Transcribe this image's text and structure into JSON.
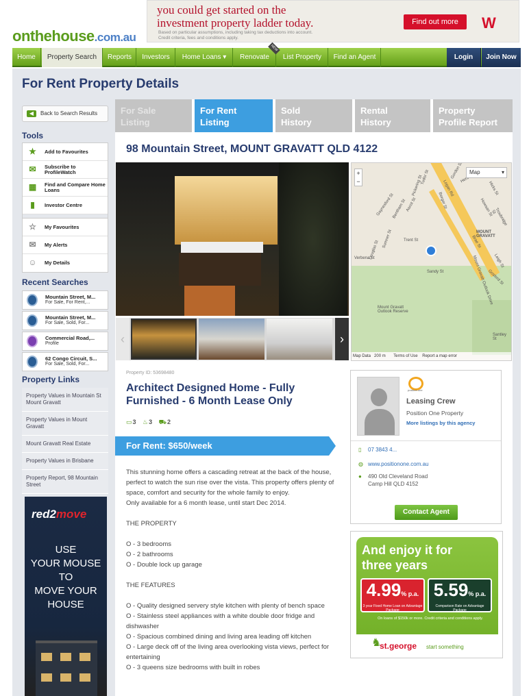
{
  "logo": {
    "part1": "onthehouse",
    "part2": ".com.au"
  },
  "banner": {
    "title_line1": "you could get started on the",
    "title_line2": "investment property ladder today.",
    "small1": "Based on particular assumptions, including taking tax deductions into account.",
    "small2": "Credit criteria, fees and conditions apply.",
    "button": "Find out more",
    "brand_mark": "W"
  },
  "nav": {
    "items": [
      "Home",
      "Property Search",
      "Reports",
      "Investors",
      "Home Loans ▾",
      "Renovate",
      "List Property",
      "Find an Agent"
    ],
    "new_tag": "NEW",
    "login": "Login",
    "join": "Join Now"
  },
  "page": {
    "title": "For Rent Property Details"
  },
  "sidebar": {
    "back": "Back to Search Results",
    "tools_heading": "Tools",
    "tools": [
      {
        "label": "Add to Favourites",
        "icon": "star-icon"
      },
      {
        "label": "Subscribe to ProfileWatch",
        "icon": "mail-icon"
      },
      {
        "label": "Find and Compare Home Loans",
        "icon": "calculator-icon"
      },
      {
        "label": "Investor Centre",
        "icon": "bar-chart-icon"
      }
    ],
    "user_tools": [
      {
        "label": "My Favourites",
        "icon": "star-outline-icon"
      },
      {
        "label": "My Alerts",
        "icon": "envelope-icon"
      },
      {
        "label": "My Details",
        "icon": "user-icon"
      }
    ],
    "recent_heading": "Recent Searches",
    "recent": [
      {
        "title": "Mountain Street, M...",
        "sub": "For Sale, For Rent,..."
      },
      {
        "title": "Mountain Street, M...",
        "sub": "For Sale, Sold, For..."
      },
      {
        "title": "Commercial Road,...",
        "sub": "Profile"
      },
      {
        "title": "62 Congo Circuit, S...",
        "sub": "For Sale, Sold, For..."
      }
    ],
    "links_heading": "Property Links",
    "links": [
      "Property Values in Mountain St Mount Gravatt",
      "Property Values in Mount Gravatt",
      "Mount Gravatt Real Estate",
      "Property Values in Brisbane",
      "Property Report, 98 Mountain Street"
    ],
    "ad": {
      "brand_a": "red2",
      "brand_b": "move",
      "text": [
        "USE",
        "YOUR MOUSE",
        "TO",
        "MOVE YOUR",
        "HOUSE"
      ]
    }
  },
  "tabs": [
    {
      "line1": "For Sale",
      "line2": "Listing"
    },
    {
      "line1": "For Rent",
      "line2": "Listing"
    },
    {
      "line1": "Sold",
      "line2": "History"
    },
    {
      "line1": "Rental",
      "line2": "History"
    },
    {
      "line1": "Property",
      "line2": "Profile Report"
    }
  ],
  "property": {
    "address": "98 Mountain Street, MOUNT GRAVATT QLD 4122",
    "id_label": "Property ID: 53698480",
    "headline": "Architect Designed Home - Fully Furnished - 6 Month Lease Only",
    "bedrooms": "3",
    "bathrooms": "3",
    "cars": "2",
    "price": "For Rent: $650/week",
    "description": [
      "This stunning home offers a cascading retreat at the back of the house, perfect to watch the sun rise over the vista. This property offers plenty of space, comfort and security for the whole family to enjoy.",
      "Only available for a 6 month lease, until start Dec 2014.",
      "",
      "THE PROPERTY",
      "",
      "O - 3 bedrooms",
      "O - 2 bathrooms",
      "O - Double lock up garage",
      "",
      "THE FEATURES",
      "",
      "O - Quality designed servery style kitchen with plenty of bench space",
      "O - Stainless steel appliances with a white double door fridge and dishwasher",
      "O - Spacious combined dining and living area leading off kitchen",
      "O - Large deck off of the living area overlooking vista views, perfect for entertaining",
      "O - 3 queens size bedrooms with built in robes"
    ]
  },
  "map": {
    "type_select": "Map",
    "zoom_in": "+",
    "zoom_out": "−",
    "labels": [
      "Logan Rd",
      "Mount Gravatt Outlook Reserve",
      "MOUNT GRAVATT",
      "Verbena St",
      "Trent St",
      "Ascot St",
      "Bentham St",
      "Gaynesford St",
      "Sumner St",
      "Douglas St",
      "Sandy St",
      "Santley St",
      "Tudor St",
      "Pickering St",
      "Gordon St",
      "Hicks St",
      "Howsan St",
      "Troubridge St",
      "Berger St",
      "Mount Gravatt Outlook Drive",
      "Gosford St",
      "Brae St",
      "Leigh St",
      "Herbert St"
    ],
    "footer": [
      "Map Data",
      "200 m",
      "Terms of Use",
      "Report a map error"
    ]
  },
  "agent": {
    "logo_text": "position one",
    "name": "Leasing Crew",
    "agency": "Position One Property",
    "more": "More listings by this agency",
    "phone": "07 3843 4...",
    "website": "www.positionone.com.au",
    "address_line1": "490 Old Cleveland Road",
    "address_line2": "Camp Hill QLD 4152",
    "contact_button": "Contact Agent"
  },
  "stgeorge": {
    "title_line1": "And enjoy it for",
    "title_line2": "three years",
    "rate1": "4.99",
    "rate1_unit": "% p.a.",
    "rate1_note": "3 year Fixed Home Loan on Advantage Package",
    "rate2": "5.59",
    "rate2_unit": "% p.a.",
    "rate2_note": "Comparison Rate on Advantage Package",
    "fine": "On loans of $150k or more. Credit criteria and conditions apply.",
    "brand": "st.george",
    "slogan": "start something"
  }
}
